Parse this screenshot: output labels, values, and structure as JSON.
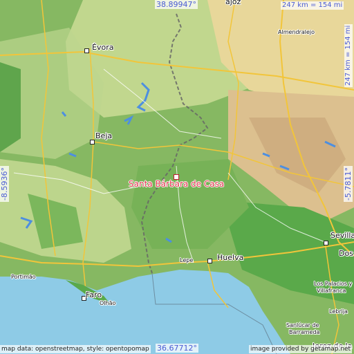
{
  "map": {
    "focus_label": "Santa Bárbara de Casa",
    "coords": {
      "top": "38.89947°",
      "bottom": "36.67712°",
      "left": "-8.5936°",
      "right": "-5.7811°"
    },
    "scale": {
      "horizontal": "247 km = 154 mi",
      "vertical": "247 km = 154 mi"
    },
    "credits": {
      "left": "map data: openstreetmap, style: opentopomap",
      "right": "image provided by getamap.net"
    },
    "places": {
      "evora": "Évora",
      "almendralejo": "Almendralejo",
      "beja": "Beja",
      "sevilla": "Sevilla",
      "dos": "Dos",
      "lepe": "Lepe",
      "huelva": "Huelva",
      "portimao": "Portimão",
      "faro": "Faro",
      "olhao": "Olhão",
      "palacios": "Los Palacios y",
      "villafranca": "Villafranca",
      "lebrija": "Lebrija",
      "sanlucar": "Sanlúcar de",
      "barrameda": "Barrameda",
      "jerez": "Jerez de la",
      "badajoz_partial": "ajoz"
    },
    "colors": {
      "lowland": "#7db35a",
      "hills": "#e8d79a",
      "mountains": "#d9b98a",
      "sea": "#8ecbe6",
      "river_valley": "#4c9b3f",
      "road": "#f2c53a",
      "border": "#666666",
      "focus": "#e0344a",
      "coord_text": "#4a5bd4"
    }
  }
}
